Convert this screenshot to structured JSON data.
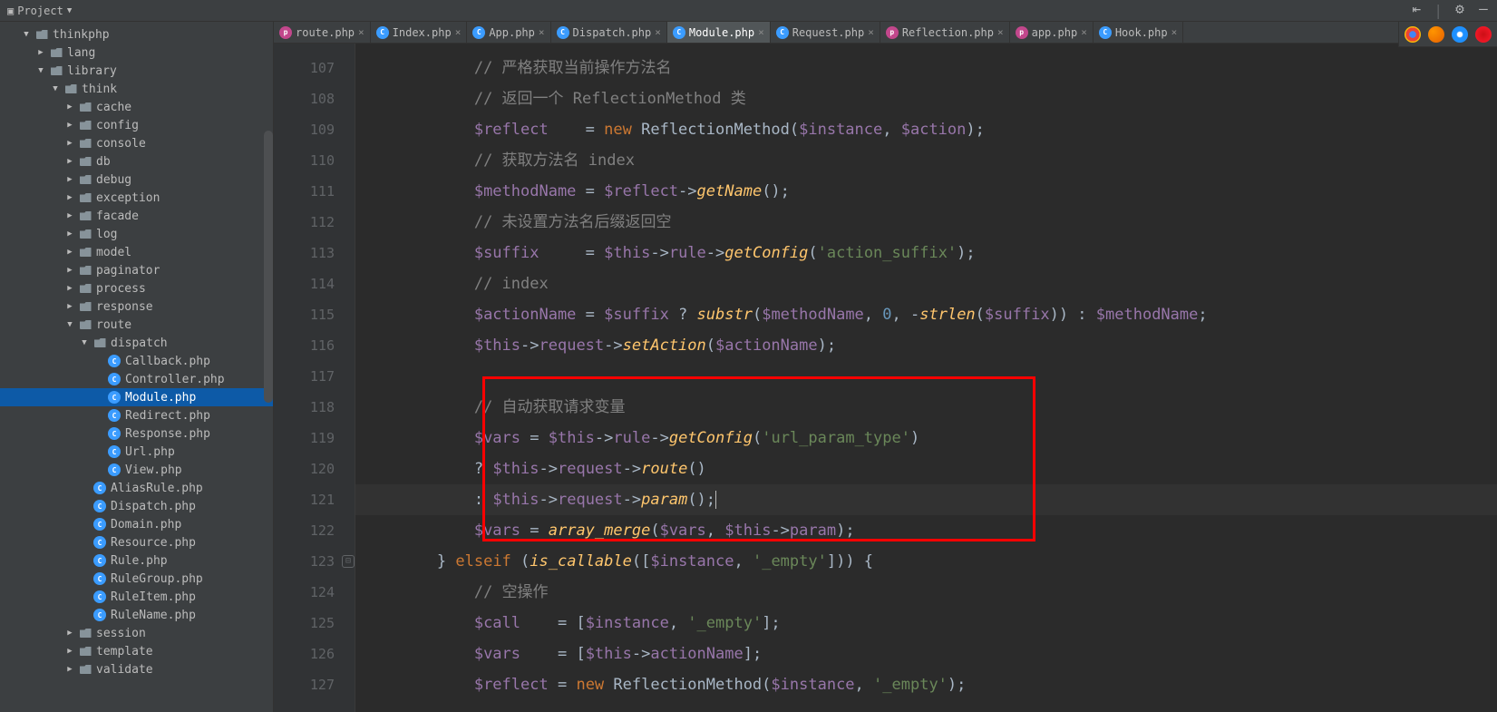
{
  "topbar": {
    "project_label": "Project"
  },
  "tabs": [
    {
      "name": "route.php",
      "icon": "p",
      "active": false
    },
    {
      "name": "Index.php",
      "icon": "c",
      "active": false
    },
    {
      "name": "App.php",
      "icon": "c",
      "active": false
    },
    {
      "name": "Dispatch.php",
      "icon": "c",
      "active": false
    },
    {
      "name": "Module.php",
      "icon": "c",
      "active": true
    },
    {
      "name": "Request.php",
      "icon": "c",
      "active": false
    },
    {
      "name": "Reflection.php",
      "icon": "p",
      "active": false
    },
    {
      "name": "app.php",
      "icon": "p",
      "active": false
    },
    {
      "name": "Hook.php",
      "icon": "c",
      "active": false
    }
  ],
  "tree": [
    {
      "indent": 1,
      "arrow": "▼",
      "icon": "folder",
      "label": "thinkphp"
    },
    {
      "indent": 2,
      "arrow": "▶",
      "icon": "folder",
      "label": "lang"
    },
    {
      "indent": 2,
      "arrow": "▼",
      "icon": "folder",
      "label": "library"
    },
    {
      "indent": 3,
      "arrow": "▼",
      "icon": "folder",
      "label": "think"
    },
    {
      "indent": 4,
      "arrow": "▶",
      "icon": "folder",
      "label": "cache"
    },
    {
      "indent": 4,
      "arrow": "▶",
      "icon": "folder",
      "label": "config"
    },
    {
      "indent": 4,
      "arrow": "▶",
      "icon": "folder",
      "label": "console"
    },
    {
      "indent": 4,
      "arrow": "▶",
      "icon": "folder",
      "label": "db"
    },
    {
      "indent": 4,
      "arrow": "▶",
      "icon": "folder",
      "label": "debug"
    },
    {
      "indent": 4,
      "arrow": "▶",
      "icon": "folder",
      "label": "exception"
    },
    {
      "indent": 4,
      "arrow": "▶",
      "icon": "folder",
      "label": "facade"
    },
    {
      "indent": 4,
      "arrow": "▶",
      "icon": "folder",
      "label": "log"
    },
    {
      "indent": 4,
      "arrow": "▶",
      "icon": "folder",
      "label": "model"
    },
    {
      "indent": 4,
      "arrow": "▶",
      "icon": "folder",
      "label": "paginator"
    },
    {
      "indent": 4,
      "arrow": "▶",
      "icon": "folder",
      "label": "process"
    },
    {
      "indent": 4,
      "arrow": "▶",
      "icon": "folder",
      "label": "response"
    },
    {
      "indent": 4,
      "arrow": "▼",
      "icon": "folder",
      "label": "route"
    },
    {
      "indent": 5,
      "arrow": "▼",
      "icon": "folder",
      "label": "dispatch"
    },
    {
      "indent": 6,
      "arrow": "",
      "icon": "php",
      "label": "Callback.php"
    },
    {
      "indent": 6,
      "arrow": "",
      "icon": "php",
      "label": "Controller.php"
    },
    {
      "indent": 6,
      "arrow": "",
      "icon": "php",
      "label": "Module.php",
      "selected": true
    },
    {
      "indent": 6,
      "arrow": "",
      "icon": "php",
      "label": "Redirect.php"
    },
    {
      "indent": 6,
      "arrow": "",
      "icon": "php",
      "label": "Response.php"
    },
    {
      "indent": 6,
      "arrow": "",
      "icon": "php",
      "label": "Url.php"
    },
    {
      "indent": 6,
      "arrow": "",
      "icon": "php",
      "label": "View.php"
    },
    {
      "indent": 5,
      "arrow": "",
      "icon": "php",
      "label": "AliasRule.php"
    },
    {
      "indent": 5,
      "arrow": "",
      "icon": "php",
      "label": "Dispatch.php"
    },
    {
      "indent": 5,
      "arrow": "",
      "icon": "php",
      "label": "Domain.php"
    },
    {
      "indent": 5,
      "arrow": "",
      "icon": "php",
      "label": "Resource.php"
    },
    {
      "indent": 5,
      "arrow": "",
      "icon": "php",
      "label": "Rule.php"
    },
    {
      "indent": 5,
      "arrow": "",
      "icon": "php",
      "label": "RuleGroup.php"
    },
    {
      "indent": 5,
      "arrow": "",
      "icon": "php",
      "label": "RuleItem.php"
    },
    {
      "indent": 5,
      "arrow": "",
      "icon": "php",
      "label": "RuleName.php"
    },
    {
      "indent": 4,
      "arrow": "▶",
      "icon": "folder",
      "label": "session"
    },
    {
      "indent": 4,
      "arrow": "▶",
      "icon": "folder",
      "label": "template"
    },
    {
      "indent": 4,
      "arrow": "▶",
      "icon": "folder",
      "label": "validate"
    }
  ],
  "gutter": {
    "lines": [
      "107",
      "108",
      "109",
      "110",
      "111",
      "112",
      "113",
      "114",
      "115",
      "116",
      "117",
      "118",
      "119",
      "120",
      "121",
      "122",
      "123",
      "124",
      "125",
      "126",
      "127"
    ]
  },
  "code": {
    "107": {
      "indent": "            ",
      "comment": "// 严格获取当前操作方法名"
    },
    "108": {
      "indent": "            ",
      "comment": "// 返回一个 ReflectionMethod 类"
    },
    "109": {
      "indent": "            ",
      "var1": "$reflect",
      "pad1": "    ",
      "eq": "= ",
      "kw": "new ",
      "class": "ReflectionMethod",
      "args_open": "(",
      "var2": "$instance",
      "comma": ", ",
      "var3": "$action",
      "args_close": ");"
    },
    "110": {
      "indent": "            ",
      "comment": "// 获取方法名 index"
    },
    "111": {
      "indent": "            ",
      "var1": "$methodName",
      "pad1": " ",
      "eq": "= ",
      "var2": "$reflect",
      "arrow": "->",
      "method": "getName",
      "call": "();"
    },
    "112": {
      "indent": "            ",
      "comment": "// 未设置方法名后缀返回空"
    },
    "113": {
      "indent": "            ",
      "var1": "$suffix",
      "pad1": "     ",
      "eq": "= ",
      "var2": "$this",
      "arrow1": "->",
      "prop1": "rule",
      "arrow2": "->",
      "method": "getConfig",
      "open": "(",
      "str": "'action_suffix'",
      "close": ");"
    },
    "114": {
      "indent": "            ",
      "comment": "// index"
    },
    "115": {
      "indent": "            ",
      "var1": "$actionName",
      "pad1": " ",
      "eq": "= ",
      "var2": "$suffix",
      "tern": " ? ",
      "func": "substr",
      "open": "(",
      "var3": "$methodName",
      "c1": ", ",
      "num1": "0",
      "c2": ", -",
      "func2": "strlen",
      "open2": "(",
      "var4": "$suffix",
      "close2": "))",
      "colon": " : ",
      "var5": "$methodName",
      "semi": ";"
    },
    "116": {
      "indent": "            ",
      "var1": "$this",
      "arrow1": "->",
      "prop1": "request",
      "arrow2": "->",
      "method": "setAction",
      "open": "(",
      "var2": "$actionName",
      "close": ");"
    },
    "117": {
      "indent": ""
    },
    "118": {
      "indent": "            ",
      "comment": "// 自动获取请求变量"
    },
    "119": {
      "indent": "            ",
      "var1": "$vars",
      "eq": " = ",
      "var2": "$this",
      "arrow1": "->",
      "prop1": "rule",
      "arrow2": "->",
      "method": "getConfig",
      "open": "(",
      "str": "'url_param_type'",
      "close": ")"
    },
    "120": {
      "indent": "            ",
      "tern": "? ",
      "var1": "$this",
      "arrow1": "->",
      "prop1": "request",
      "arrow2": "->",
      "method": "route",
      "call": "()"
    },
    "121": {
      "indent": "            ",
      "colon": ": ",
      "var1": "$this",
      "arrow1": "->",
      "prop1": "request",
      "arrow2": "->",
      "method": "param",
      "call": "();"
    },
    "122": {
      "indent": "            ",
      "var1": "$vars",
      "eq": " = ",
      "func": "array_merge",
      "open": "(",
      "var2": "$vars",
      "c1": ", ",
      "var3": "$this",
      "arrow": "->",
      "prop": "param",
      "close": ");"
    },
    "123": {
      "indent": "        ",
      "brace": "} ",
      "kw": "elseif ",
      "open": "(",
      "func": "is_callable",
      "open2": "([",
      "var1": "$instance",
      "c1": ", ",
      "str": "'_empty'",
      "close2": "])) {",
      "marker": true
    },
    "124": {
      "indent": "            ",
      "comment": "// 空操作"
    },
    "125": {
      "indent": "            ",
      "var1": "$call",
      "pad": "    ",
      "eq": "= [",
      "var2": "$instance",
      "c1": ", ",
      "str": "'_empty'",
      "close": "];"
    },
    "126": {
      "indent": "            ",
      "var1": "$vars",
      "pad": "    ",
      "eq": "= [",
      "var2": "$this",
      "arrow": "->",
      "prop": "actionName",
      "close": "];"
    },
    "127": {
      "indent": "            ",
      "var1": "$reflect",
      "pad": " ",
      "eq": "= ",
      "kw": "new ",
      "class": "ReflectionMethod",
      "open": "(",
      "var2": "$instance",
      "c1": ", ",
      "str": "'_empty'",
      "close": ");"
    }
  }
}
